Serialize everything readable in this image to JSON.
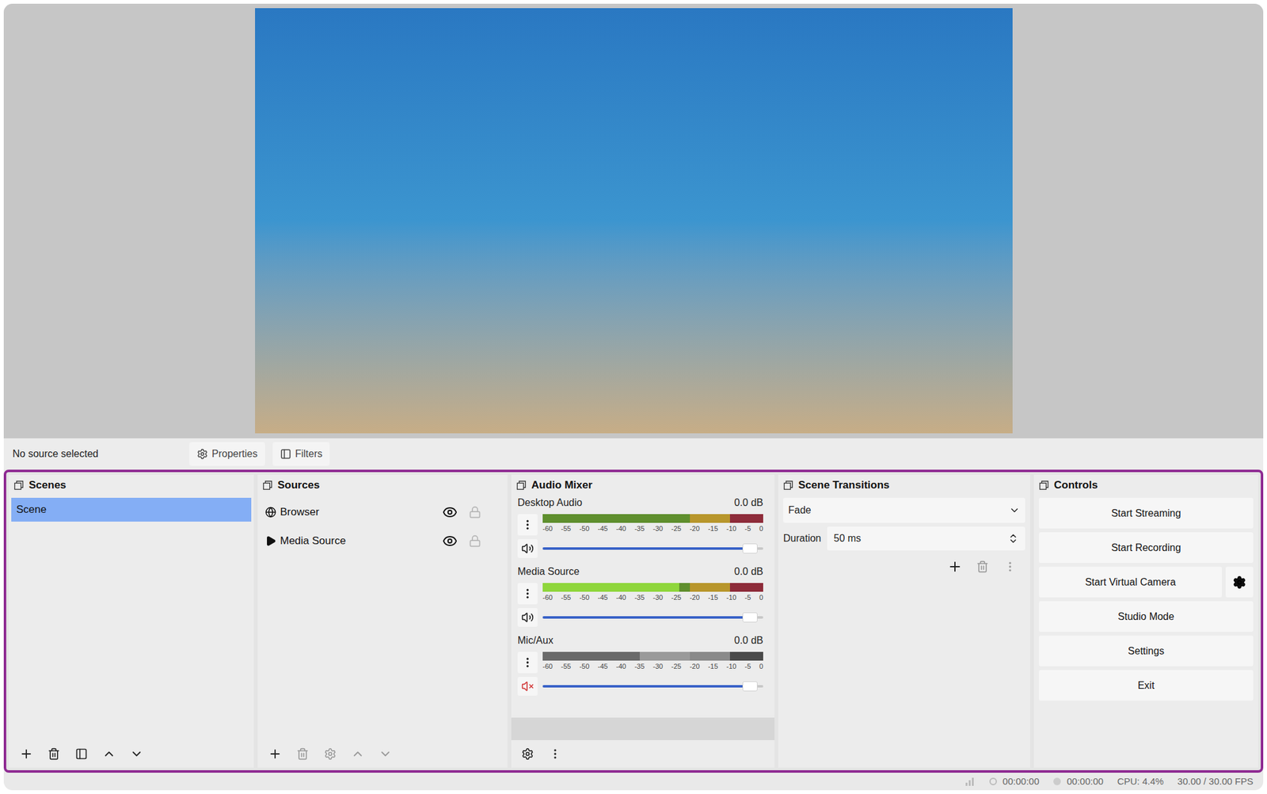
{
  "toolbar": {
    "status": "No source selected",
    "buttons": [
      "Properties",
      "Filters"
    ]
  },
  "scenes": {
    "title": "Scenes",
    "items": [
      {
        "label": "Scene",
        "selected": true
      }
    ]
  },
  "sources": {
    "title": "Sources",
    "items": [
      {
        "label": "Browser",
        "kind": "browser",
        "visible": true,
        "locked": false
      },
      {
        "label": "Media Source",
        "kind": "media",
        "visible": true,
        "locked": false
      }
    ]
  },
  "mixer": {
    "title": "Audio Mixer",
    "scale": [
      "-60",
      "-55",
      "-50",
      "-45",
      "-40",
      "-35",
      "-30",
      "-25",
      "-20",
      "-15",
      "-10",
      "-5",
      "0"
    ],
    "channels": [
      {
        "name": "Desktop Audio",
        "reading": "0.0 dB",
        "muted": false,
        "level": 0,
        "volume": 0.97
      },
      {
        "name": "Media Source",
        "reading": "0.0 dB",
        "muted": false,
        "level": 0.62,
        "volume": 0.97
      },
      {
        "name": "Mic/Aux",
        "reading": "0.0 dB",
        "muted": true,
        "level": 0.44,
        "volume": 0.97
      }
    ]
  },
  "transitions": {
    "title": "Scene Transitions",
    "transition": "Fade",
    "duration_label": "Duration",
    "duration": "50 ms"
  },
  "controls": {
    "title": "Controls",
    "buttons": [
      {
        "label": "Start Streaming",
        "settings": false
      },
      {
        "label": "Start Recording",
        "settings": false
      },
      {
        "label": "Start Virtual Camera",
        "settings": true
      },
      {
        "label": "Studio Mode",
        "settings": false
      },
      {
        "label": "Settings",
        "settings": false
      },
      {
        "label": "Exit",
        "settings": false
      }
    ]
  },
  "status_bar": {
    "stream_time": "00:00:00",
    "record_time": "00:00:00",
    "cpu": "CPU: 4.4%",
    "fps": "30.00 / 30.00 FPS"
  }
}
